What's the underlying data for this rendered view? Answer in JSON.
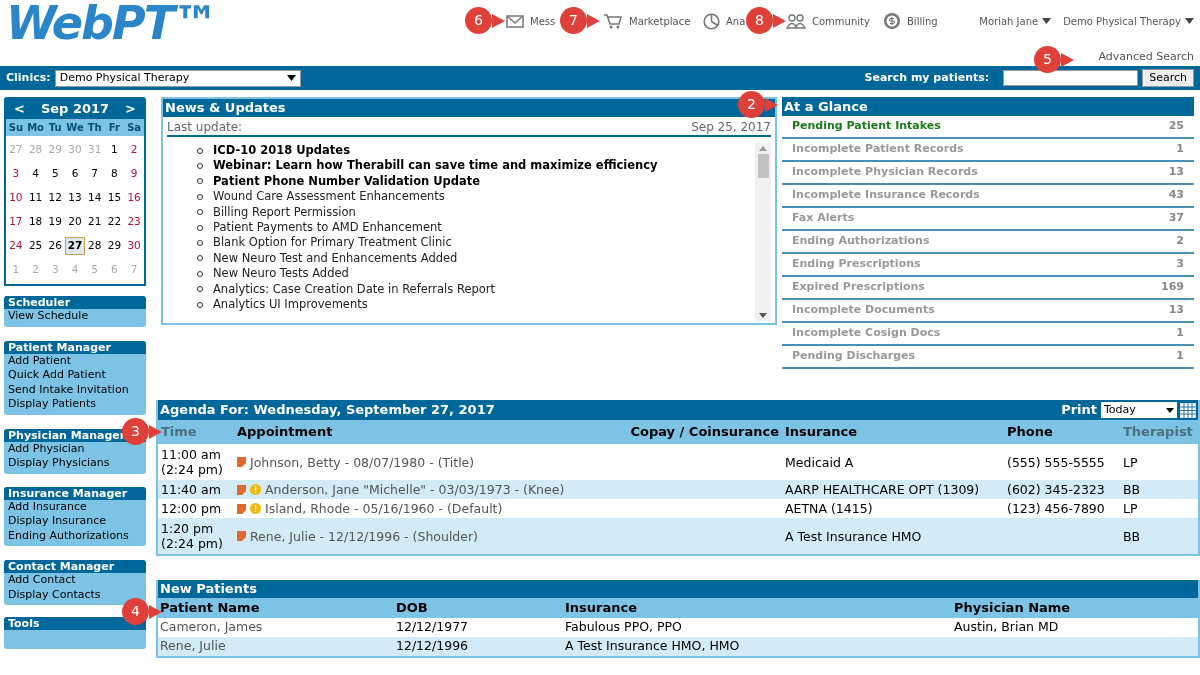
{
  "logo": "WebPT™",
  "nav": [
    {
      "label": "Mess",
      "kind": "mail"
    },
    {
      "label": "Marketplace",
      "kind": "cart"
    },
    {
      "label": "Ana",
      "kind": "chart"
    },
    {
      "label": "Community",
      "kind": "people"
    },
    {
      "label": "Billing",
      "kind": "money"
    }
  ],
  "user_menus": [
    "Moriah Jane",
    "Demo Physical Therapy"
  ],
  "advanced_search": "Advanced Search",
  "toolbar": {
    "clinics_label": "Clinics:",
    "clinic": "Demo Physical Therapy",
    "search_label": "Search my patients:",
    "search_button": "Search"
  },
  "calendar": {
    "prev": "<",
    "month": "Sep 2017",
    "next": ">",
    "weekdays": [
      "Su",
      "Mo",
      "Tu",
      "We",
      "Th",
      "Fr",
      "Sa"
    ],
    "weeks": [
      [
        {
          "label": "27",
          "kind": "other",
          "selected": false
        },
        {
          "label": "28",
          "kind": "other",
          "selected": false
        },
        {
          "label": "29",
          "kind": "other",
          "selected": false
        },
        {
          "label": "30",
          "kind": "other",
          "selected": false
        },
        {
          "label": "31",
          "kind": "other",
          "selected": false
        },
        {
          "label": "1",
          "kind": "current",
          "selected": false
        },
        {
          "label": "2",
          "kind": "current",
          "selected": false
        }
      ],
      [
        {
          "label": "3",
          "kind": "current",
          "selected": false
        },
        {
          "label": "4",
          "kind": "current",
          "selected": false
        },
        {
          "label": "5",
          "kind": "current",
          "selected": false
        },
        {
          "label": "6",
          "kind": "current",
          "selected": false
        },
        {
          "label": "7",
          "kind": "current",
          "selected": false
        },
        {
          "label": "8",
          "kind": "current",
          "selected": false
        },
        {
          "label": "9",
          "kind": "current",
          "selected": false
        }
      ],
      [
        {
          "label": "10",
          "kind": "current",
          "selected": false
        },
        {
          "label": "11",
          "kind": "current",
          "selected": false
        },
        {
          "label": "12",
          "kind": "current",
          "selected": false
        },
        {
          "label": "13",
          "kind": "current",
          "selected": false
        },
        {
          "label": "14",
          "kind": "current",
          "selected": false
        },
        {
          "label": "15",
          "kind": "current",
          "selected": false
        },
        {
          "label": "16",
          "kind": "current",
          "selected": false
        }
      ],
      [
        {
          "label": "17",
          "kind": "current",
          "selected": false
        },
        {
          "label": "18",
          "kind": "current",
          "selected": false
        },
        {
          "label": "19",
          "kind": "current",
          "selected": false
        },
        {
          "label": "20",
          "kind": "current",
          "selected": false
        },
        {
          "label": "21",
          "kind": "current",
          "selected": false
        },
        {
          "label": "22",
          "kind": "current",
          "selected": false
        },
        {
          "label": "23",
          "kind": "current",
          "selected": false
        }
      ],
      [
        {
          "label": "24",
          "kind": "current",
          "selected": false
        },
        {
          "label": "25",
          "kind": "current",
          "selected": false
        },
        {
          "label": "26",
          "kind": "current",
          "selected": false
        },
        {
          "label": "27",
          "kind": "current",
          "selected": true
        },
        {
          "label": "28",
          "kind": "current",
          "selected": false
        },
        {
          "label": "29",
          "kind": "current",
          "selected": false
        },
        {
          "label": "30",
          "kind": "current",
          "selected": false
        }
      ],
      [
        {
          "label": "1",
          "kind": "other",
          "selected": false
        },
        {
          "label": "2",
          "kind": "other",
          "selected": false
        },
        {
          "label": "3",
          "kind": "other",
          "selected": false
        },
        {
          "label": "4",
          "kind": "other",
          "selected": false
        },
        {
          "label": "5",
          "kind": "other",
          "selected": false
        },
        {
          "label": "6",
          "kind": "other",
          "selected": false
        },
        {
          "label": "7",
          "kind": "other",
          "selected": false
        }
      ]
    ]
  },
  "sidebar": [
    {
      "title": "Scheduler",
      "links": [
        "View Schedule"
      ]
    },
    {
      "title": "Patient Manager",
      "links": [
        "Add Patient",
        "Quick Add Patient",
        "Send Intake Invitation",
        "Display Patients"
      ]
    },
    {
      "title": "Physician Manager",
      "links": [
        "Add Physician",
        "Display Physicians"
      ]
    },
    {
      "title": "Insurance Manager",
      "links": [
        "Add Insurance",
        "Display Insurance",
        "Ending Authorizations"
      ]
    },
    {
      "title": "Contact Manager",
      "links": [
        "Add Contact",
        "Display Contacts"
      ]
    },
    {
      "title": "Tools"
    }
  ],
  "news": {
    "title": "News & Updates",
    "last_update_label": "Last update:",
    "last_update": "Sep 25, 2017",
    "items": [
      {
        "text": "ICD-10 2018 Updates",
        "bold": true
      },
      {
        "text": "Webinar: Learn how Therabill can save time and maximize efficiency",
        "bold": true
      },
      {
        "text": "Patient Phone Number Validation Update",
        "bold": true
      },
      {
        "text": "Wound Care Assessment Enhancements",
        "bold": false
      },
      {
        "text": "Billing Report Permission",
        "bold": false
      },
      {
        "text": "Patient Payments to AMD Enhancement",
        "bold": false
      },
      {
        "text": "Blank Option for Primary Treatment Clinic",
        "bold": false
      },
      {
        "text": "New Neuro Test and Enhancements Added",
        "bold": false
      },
      {
        "text": "New Neuro Tests Added",
        "bold": false
      },
      {
        "text": "Analytics: Case Creation Date in Referrals Report",
        "bold": false
      },
      {
        "text": "Analytics UI Improvements",
        "bold": false
      }
    ]
  },
  "at_a_glance": {
    "title": "At a Glance",
    "items": [
      {
        "label": "Pending Patient Intakes",
        "count": "25",
        "active": true
      },
      {
        "label": "Incomplete Patient Records",
        "count": "1",
        "active": false
      },
      {
        "label": "Incomplete Physician Records",
        "count": "13",
        "active": false
      },
      {
        "label": "Incomplete Insurance Records",
        "count": "43",
        "active": false
      },
      {
        "label": "Fax Alerts",
        "count": "37",
        "active": false
      },
      {
        "label": "Ending Authorizations",
        "count": "2",
        "active": false
      },
      {
        "label": "Ending Prescriptions",
        "count": "3",
        "active": false
      },
      {
        "label": "Expired Prescriptions",
        "count": "169",
        "active": false
      },
      {
        "label": "Incomplete Documents",
        "count": "13",
        "active": false
      },
      {
        "label": "Incomplete Cosign Docs",
        "count": "1",
        "active": false
      },
      {
        "label": "Pending Discharges",
        "count": "1",
        "active": false
      }
    ]
  },
  "agenda": {
    "title": "Agenda For: Wednesday, September 27, 2017",
    "print_label": "Print",
    "range": "Today",
    "columns": [
      {
        "label": "Time",
        "muted": true
      },
      {
        "label": "Appointment",
        "muted": false
      },
      {
        "label": "Copay / Coinsurance",
        "muted": false
      },
      {
        "label": "Insurance",
        "muted": false
      },
      {
        "label": "Phone",
        "muted": false
      },
      {
        "label": "Therapist",
        "muted": true
      }
    ],
    "rows": [
      {
        "time": "11:00 am",
        "time_note": "(2:24 pm)",
        "appointment": "Johnson, Betty - 08/07/1980 - (Title)",
        "alert": false,
        "insurance": "Medicaid A",
        "phone": "(555) 555-5555",
        "therapist": "LP"
      },
      {
        "time": "11:40 am",
        "appointment": "Anderson, Jane \"Michelle\" - 03/03/1973 - (Knee)",
        "alert": true,
        "insurance": "AARP HEALTHCARE OPT (1309)",
        "phone": "(602) 345-2323",
        "therapist": "BB"
      },
      {
        "time": "12:00 pm",
        "appointment": "Island, Rhode - 05/16/1960 - (Default)",
        "alert": true,
        "insurance": "AETNA (1415)",
        "phone": "(123) 456-7890",
        "therapist": "LP"
      },
      {
        "time": "1:20 pm",
        "time_note": "(2:24 pm)",
        "appointment": "Rene, Julie - 12/12/1996 - (Shoulder)",
        "alert": false,
        "insurance": "A Test Insurance HMO",
        "therapist": "BB"
      }
    ]
  },
  "new_patients": {
    "title": "New Patients",
    "columns": [
      "Patient Name",
      "DOB",
      "Insurance",
      "Physician Name"
    ],
    "rows": [
      {
        "name": "Cameron, James",
        "dob": "12/12/1977",
        "insurance": "Fabulous PPO, PPO",
        "physician": "Austin, Brian MD"
      },
      {
        "name": "Rene, Julie",
        "dob": "12/12/1996",
        "insurance": "A Test Insurance HMO, HMO"
      }
    ]
  },
  "callouts": [
    "6",
    "7",
    "8",
    "5",
    "2",
    "3",
    "4"
  ]
}
